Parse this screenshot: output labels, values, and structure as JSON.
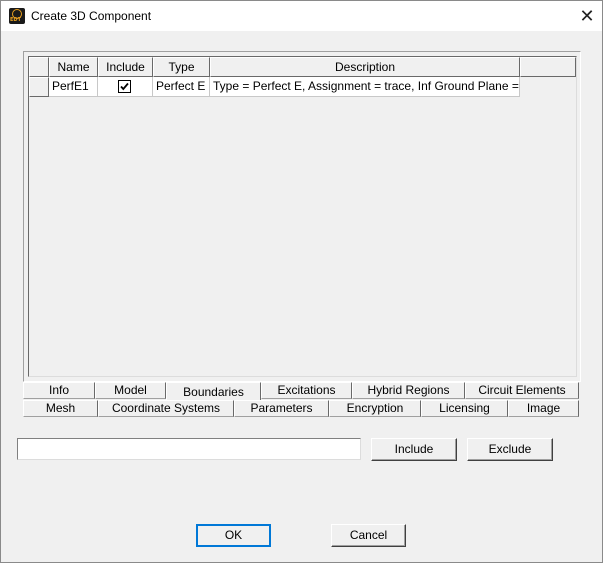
{
  "window": {
    "title": "Create 3D Component",
    "icon_name": "edt-app-icon",
    "icon_text": "EDT",
    "close_glyph": "✕"
  },
  "table": {
    "columns": [
      "",
      "Name",
      "Include",
      "Type",
      "Description",
      ""
    ],
    "rows": [
      {
        "name": "PerfE1",
        "include": true,
        "type": "Perfect E",
        "description": "Type = Perfect E, Assignment = trace, Inf Ground Plane = false"
      }
    ]
  },
  "tabs": {
    "row1": [
      "Info",
      "Model",
      "Boundaries",
      "Excitations",
      "Hybrid Regions",
      "Circuit Elements"
    ],
    "row2": [
      "Mesh",
      "Coordinate Systems",
      "Parameters",
      "Encryption",
      "Licensing",
      "Image"
    ],
    "active": "Boundaries"
  },
  "filter": {
    "value": "",
    "placeholder": ""
  },
  "buttons": {
    "include": "Include",
    "exclude": "Exclude",
    "ok": "OK",
    "cancel": "Cancel"
  }
}
